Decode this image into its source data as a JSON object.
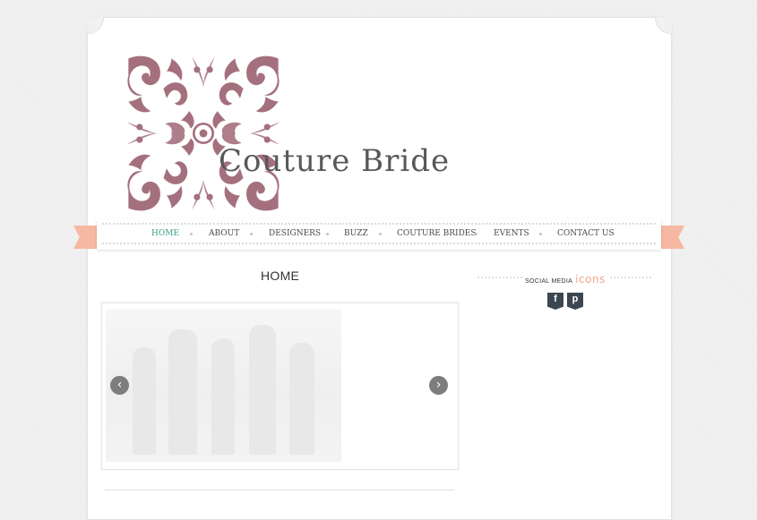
{
  "site": {
    "brand_name": "Couture Bride"
  },
  "nav": {
    "items": [
      {
        "label": "HOME",
        "active": true
      },
      {
        "label": "ABOUT",
        "active": false
      },
      {
        "label": "DESIGNERS",
        "active": false
      },
      {
        "label": "BUZZ",
        "active": false
      },
      {
        "label": "COUTURE BRIDES",
        "active": false
      },
      {
        "label": "EVENTS",
        "active": false
      },
      {
        "label": "CONTACT US",
        "active": false
      }
    ]
  },
  "main": {
    "title": "HOME",
    "slider": {
      "prev_icon": "chevron-left-icon",
      "next_icon": "chevron-right-icon"
    }
  },
  "sidebar": {
    "social": {
      "label_small": "SOCIAL MEDIA",
      "label_big": "icons",
      "icons": [
        {
          "name": "facebook-icon",
          "glyph": "f"
        },
        {
          "name": "pinterest-icon",
          "glyph": "p"
        }
      ]
    }
  },
  "colors": {
    "logo": "#a5707e",
    "accent_active_nav": "#3aa08a",
    "ribbon": "#f6b8a2",
    "social_icon_bg": "#3b4650",
    "social_accent": "#f0a78b"
  }
}
